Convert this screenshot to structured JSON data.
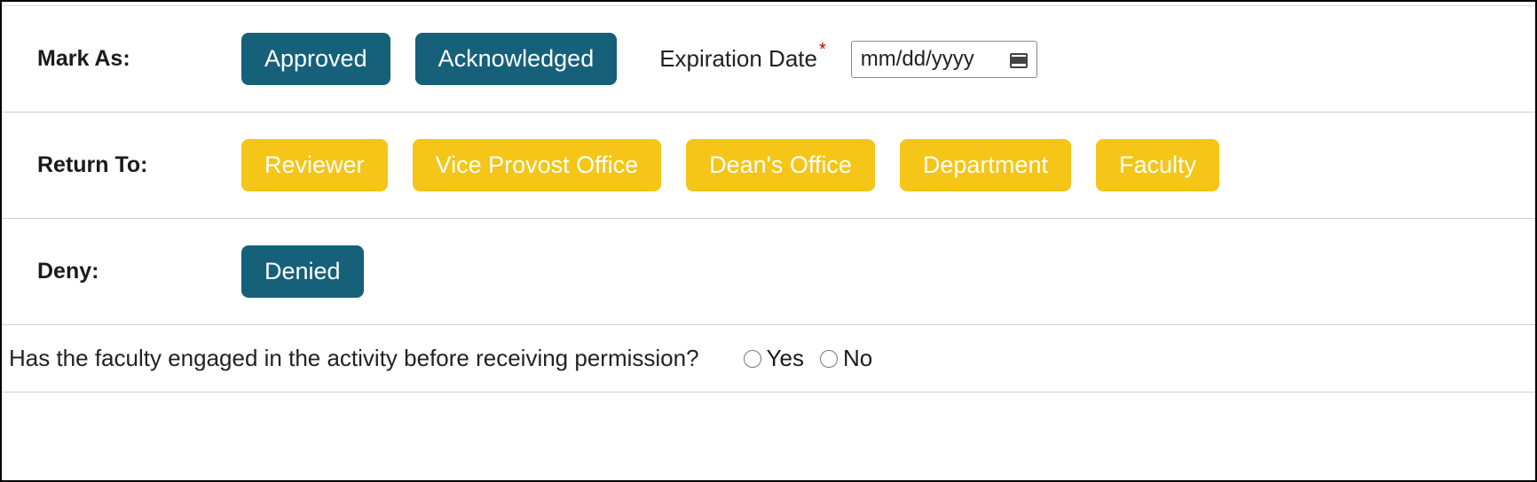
{
  "markAs": {
    "label": "Mark As:",
    "approvedLabel": "Approved",
    "acknowledgedLabel": "Acknowledged",
    "expirationLabel": "Expiration Date",
    "expirationPlaceholder": "mm/dd/yyyy"
  },
  "returnTo": {
    "label": "Return To:",
    "reviewerLabel": "Reviewer",
    "viceProvostLabel": "Vice Provost Office",
    "deansOfficeLabel": "Dean's Office",
    "departmentLabel": "Department",
    "facultyLabel": "Faculty"
  },
  "deny": {
    "label": "Deny:",
    "deniedLabel": "Denied"
  },
  "question": {
    "text": "Has the faculty engaged in the activity before receiving permission?",
    "yesLabel": "Yes",
    "noLabel": "No"
  }
}
